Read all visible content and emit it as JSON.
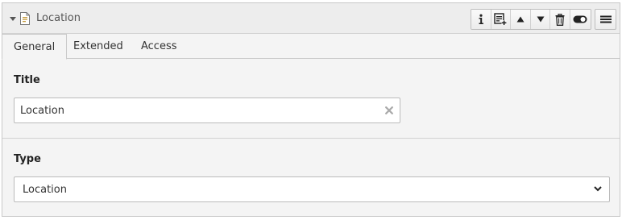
{
  "header": {
    "title": "Location",
    "toolbar": {
      "info_icon": "info-icon",
      "new_record_icon": "new-record-icon",
      "move_up_icon": "arrow-up-icon",
      "move_down_icon": "arrow-down-icon",
      "delete_icon": "trash-icon",
      "toggle_icon": "toggle-icon",
      "menu_icon": "hamburger-menu-icon"
    }
  },
  "tabs": [
    {
      "label": "General",
      "active": true
    },
    {
      "label": "Extended",
      "active": false
    },
    {
      "label": "Access",
      "active": false
    }
  ],
  "fields": {
    "title": {
      "label": "Title",
      "value": "Location"
    },
    "type": {
      "label": "Type",
      "value": "Location"
    }
  },
  "colors": {
    "header_bg": "#ededed",
    "panel_bg": "#f4f4f4",
    "border": "#c9c9c9"
  }
}
